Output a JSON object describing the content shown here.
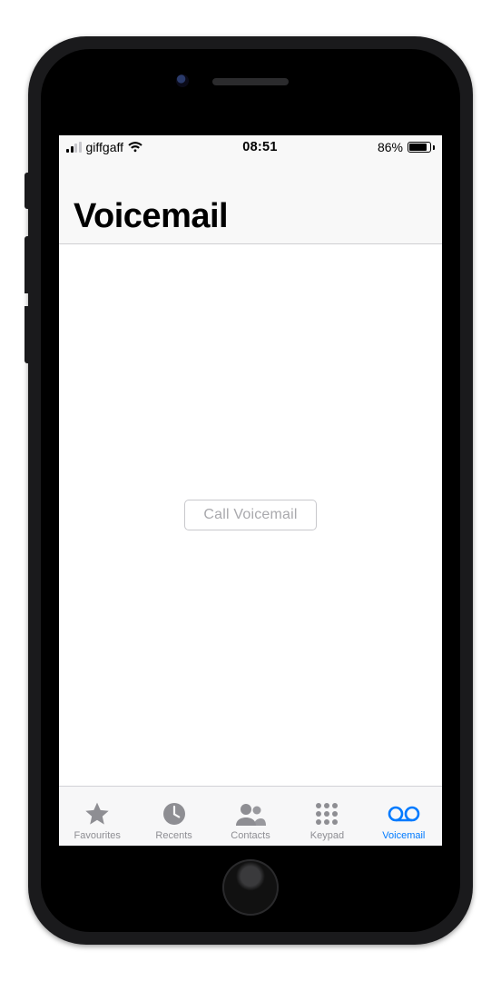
{
  "status_bar": {
    "carrier": "giffgaff",
    "time": "08:51",
    "battery_percent_label": "86%",
    "battery_fill_percent": 86
  },
  "header": {
    "title": "Voicemail"
  },
  "content": {
    "call_voicemail_label": "Call Voicemail"
  },
  "tabs": {
    "favourites": "Favourites",
    "recents": "Recents",
    "contacts": "Contacts",
    "keypad": "Keypad",
    "voicemail": "Voicemail",
    "active": "voicemail"
  }
}
